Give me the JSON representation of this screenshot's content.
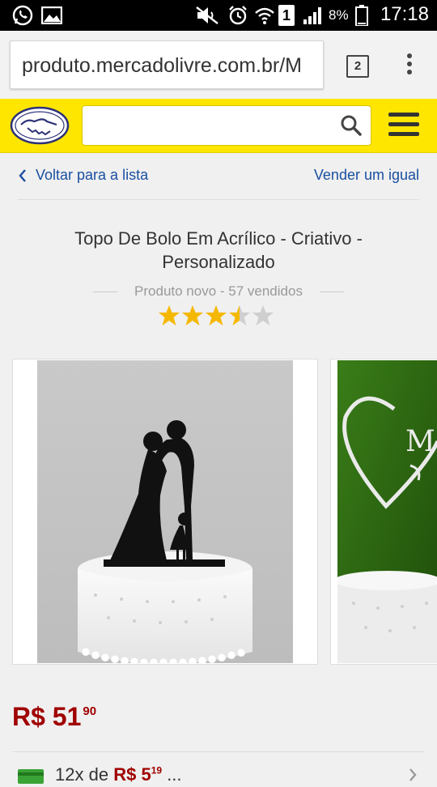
{
  "status_bar": {
    "time": "17:18",
    "battery": "8%",
    "sim": "1",
    "icons": [
      "whatsapp-icon",
      "image-icon",
      "mute-icon",
      "alarm-icon",
      "wifi-icon",
      "signal-icon",
      "battery-icon"
    ]
  },
  "browser": {
    "url": "produto.mercadolivre.com.br/M",
    "tab_count": "2"
  },
  "header": {
    "brand_color": "#ffe600",
    "search_placeholder": ""
  },
  "nav": {
    "back_label": "Voltar para a lista",
    "sell_label": "Vender um igual"
  },
  "product": {
    "title": "Topo De Bolo Em Acrílico - Criativo - Personalizado",
    "condition": "Produto novo - 57 vendidos",
    "rating": 3.5,
    "rating_max": 5,
    "price_main": "R$ 51",
    "price_cents": "90",
    "installments_prefix": "12x",
    "installments_label": "de",
    "installments_value": "R$ 5",
    "installments_cents": "19",
    "installments_suffix": "..."
  },
  "colors": {
    "accent_blue": "#1a4fa0",
    "price_red": "#a00000",
    "star_gold": "#f5b800"
  }
}
